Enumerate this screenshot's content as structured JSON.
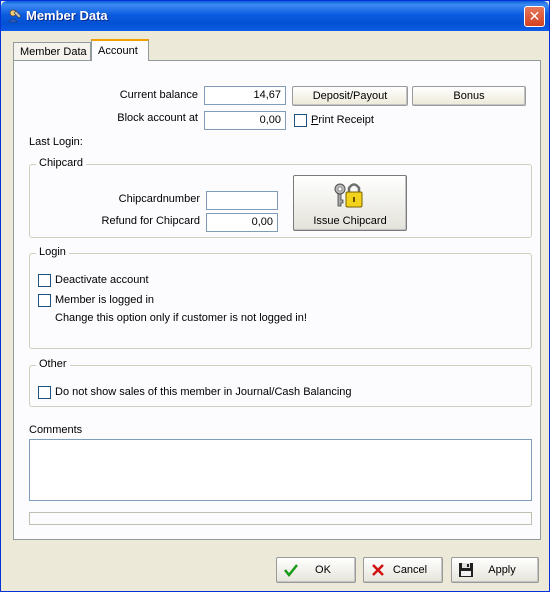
{
  "window": {
    "title": "Member Data",
    "close_glyph": "✕"
  },
  "tabs": [
    {
      "label": "Member Data",
      "active": false
    },
    {
      "label": "Account",
      "active": true
    }
  ],
  "account": {
    "current_balance_label": "Current balance",
    "current_balance_value": "14,67",
    "block_account_label": "Block account at",
    "block_account_value": "0,00",
    "deposit_payout_label": "Deposit/Payout",
    "bonus_label": "Bonus",
    "print_receipt_first": "P",
    "print_receipt_rest": "rint Receipt",
    "print_receipt_checked": false,
    "last_login_label": "Last Login:"
  },
  "chipcard": {
    "legend": "Chipcard",
    "number_label": "Chipcardnumber",
    "number_value": "",
    "refund_label": "Refund for Chipcard",
    "refund_value": "0,00",
    "issue_button_label": "Issue Chipcard",
    "issue_button_icon": "keys-lock-icon"
  },
  "login": {
    "legend": "Login",
    "deactivate_label": "Deactivate account",
    "deactivate_checked": false,
    "logged_in_label": "Member is logged in",
    "logged_in_checked": false,
    "note": "Change this option only if customer is not logged in!"
  },
  "other": {
    "legend": "Other",
    "hide_sales_label": "Do not show sales of this member in Journal/Cash Balancing",
    "hide_sales_checked": false
  },
  "comments": {
    "label": "Comments",
    "value": ""
  },
  "footer": {
    "ok_label": "OK",
    "ok_icon": "checkmark-icon",
    "cancel_label": "Cancel",
    "cancel_icon": "x-icon",
    "apply_label": "Apply",
    "apply_icon": "floppy-disk-icon"
  },
  "colors": {
    "titlebar": "#0c5ce0",
    "ok_green": "#1a9a1a",
    "cancel_red": "#d01010",
    "tab_highlight": "#f0a000"
  }
}
